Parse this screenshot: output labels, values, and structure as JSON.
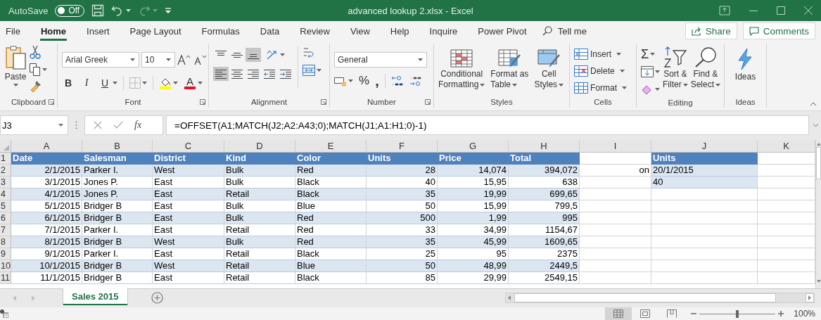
{
  "title_bar": {
    "autosave_label": "AutoSave",
    "autosave": {
      "on": false,
      "label": "Off"
    },
    "title": "advanced lookup 2.xlsx  -  Excel"
  },
  "ribbon_tabs": [
    {
      "label": "File",
      "selected": false
    },
    {
      "label": "Home",
      "selected": true
    },
    {
      "label": "Insert",
      "selected": false
    },
    {
      "label": "Page Layout",
      "selected": false
    },
    {
      "label": "Formulas",
      "selected": false
    },
    {
      "label": "Data",
      "selected": false
    },
    {
      "label": "Review",
      "selected": false
    },
    {
      "label": "View",
      "selected": false
    },
    {
      "label": "Help",
      "selected": false
    },
    {
      "label": "Inquire",
      "selected": false
    },
    {
      "label": "Power Pivot",
      "selected": false
    }
  ],
  "tell_me": "Tell me",
  "share": "Share",
  "comments": "Comments",
  "ribbon": {
    "clipboard": {
      "paste": "Paste",
      "label": "Clipboard"
    },
    "font": {
      "name": "Arial Greek",
      "size": "10",
      "bold": "B",
      "italic": "I",
      "underline": "U",
      "font_color": "A",
      "label": "Font"
    },
    "alignment": {
      "buttons": [
        {
          "kind": "align_top",
          "selected": false
        },
        {
          "kind": "align_middle",
          "selected": false
        },
        {
          "kind": "align_bottom",
          "selected": true
        },
        {
          "kind": "align_left",
          "selected": true
        },
        {
          "kind": "align_center",
          "selected": false
        },
        {
          "kind": "align_right",
          "selected": false
        },
        {
          "kind": "outdent",
          "selected": false
        },
        {
          "kind": "indent",
          "selected": false
        }
      ],
      "label": "Alignment"
    },
    "number": {
      "format": "General",
      "percent": "%",
      "comma": ",",
      "label": "Number"
    },
    "styles": {
      "buttons": [
        {
          "kind": "conditional",
          "lines": [
            "Conditional",
            "Formatting"
          ]
        },
        {
          "kind": "table",
          "lines": [
            "Format as",
            "Table"
          ]
        },
        {
          "kind": "cell",
          "lines": [
            "Cell",
            "Styles"
          ]
        }
      ],
      "label": "Styles"
    },
    "cells": {
      "buttons": [
        {
          "kind": "insert",
          "label": "Insert"
        },
        {
          "kind": "delete",
          "label": "Delete"
        },
        {
          "kind": "format",
          "label": "Format"
        }
      ],
      "label": "Cells"
    },
    "editing": {
      "autosum": "Σ",
      "buttons": [
        {
          "kind": "sort",
          "lines": [
            "Sort &",
            "Filter"
          ]
        },
        {
          "kind": "find",
          "lines": [
            "Find &",
            "Select"
          ]
        }
      ],
      "label": "Editing"
    },
    "ideas": {
      "button": "Ideas",
      "label": "Ideas"
    }
  },
  "formula_bar": {
    "name_box": "J3",
    "insert_function": "fx",
    "formula": "=OFFSET(A1;MATCH(J2;A2:A43;0);MATCH(J1;A1:H1;0)-1)"
  },
  "sheet": {
    "columns": [
      "A",
      "B",
      "C",
      "D",
      "E",
      "F",
      "G",
      "H",
      "I",
      "J",
      "K"
    ],
    "row_numbers": [
      "1",
      "2",
      "3",
      "4",
      "5",
      "6",
      "7",
      "8",
      "9",
      "10",
      "11"
    ]
  },
  "sales_table": {
    "columns": [
      {
        "label": "Date",
        "numeric": true
      },
      {
        "label": "Salesman",
        "numeric": false
      },
      {
        "label": "District",
        "numeric": false
      },
      {
        "label": "Kind",
        "numeric": false
      },
      {
        "label": "Color",
        "numeric": false
      },
      {
        "label": "Units",
        "numeric": true
      },
      {
        "label": "Price",
        "numeric": true
      },
      {
        "label": "Total",
        "numeric": true
      }
    ],
    "rows": [
      {
        "banded": true,
        "cells": [
          "2/1/2015",
          "Parker I.",
          "West",
          "Bulk",
          "Red",
          "28",
          "14,074",
          "394,072"
        ]
      },
      {
        "banded": false,
        "cells": [
          "3/1/2015",
          "Jones P.",
          "East",
          "Bulk",
          "Black",
          "40",
          "15,95",
          "638"
        ]
      },
      {
        "banded": true,
        "cells": [
          "4/1/2015",
          "Jones P.",
          "East",
          "Retail",
          "Black",
          "35",
          "19,99",
          "699,65"
        ]
      },
      {
        "banded": false,
        "cells": [
          "5/1/2015",
          "Bridger B",
          "East",
          "Bulk",
          "Blue",
          "50",
          "15,99",
          "799,5"
        ]
      },
      {
        "banded": true,
        "cells": [
          "6/1/2015",
          "Bridger B",
          "East",
          "Bulk",
          "Red",
          "500",
          "1,99",
          "995"
        ]
      },
      {
        "banded": false,
        "cells": [
          "7/1/2015",
          "Parker I.",
          "East",
          "Retail",
          "Red",
          "33",
          "34,99",
          "1154,67"
        ]
      },
      {
        "banded": true,
        "cells": [
          "8/1/2015",
          "Bridger B",
          "West",
          "Bulk",
          "Red",
          "35",
          "45,99",
          "1609,65"
        ]
      },
      {
        "banded": false,
        "cells": [
          "9/1/2015",
          "Parker I.",
          "East",
          "Retail",
          "Black",
          "25",
          "95",
          "2375"
        ]
      },
      {
        "banded": true,
        "cells": [
          "10/1/2015",
          "Bridger B",
          "West",
          "Retail",
          "Blue",
          "50",
          "48,99",
          "2449,5"
        ]
      },
      {
        "banded": false,
        "cells": [
          "11/1/2015",
          "Bridger B",
          "East",
          "Retail",
          "Black",
          "85",
          "29,99",
          "2549,15"
        ]
      }
    ]
  },
  "side_label": "on",
  "lookup_table": {
    "header": "Units",
    "rows": [
      {
        "banded": true,
        "text": "20/1/2015"
      },
      {
        "banded": true,
        "text": "40"
      }
    ]
  },
  "sheet_tabs": [
    {
      "label": "Sales 2015",
      "selected": true
    }
  ],
  "status_bar": {
    "views": [
      {
        "kind": "normal",
        "selected": true
      },
      {
        "kind": "page_layout",
        "selected": false
      },
      {
        "kind": "page_break",
        "selected": false
      }
    ],
    "zoom": {
      "level": 0.5,
      "label": "100%"
    }
  }
}
